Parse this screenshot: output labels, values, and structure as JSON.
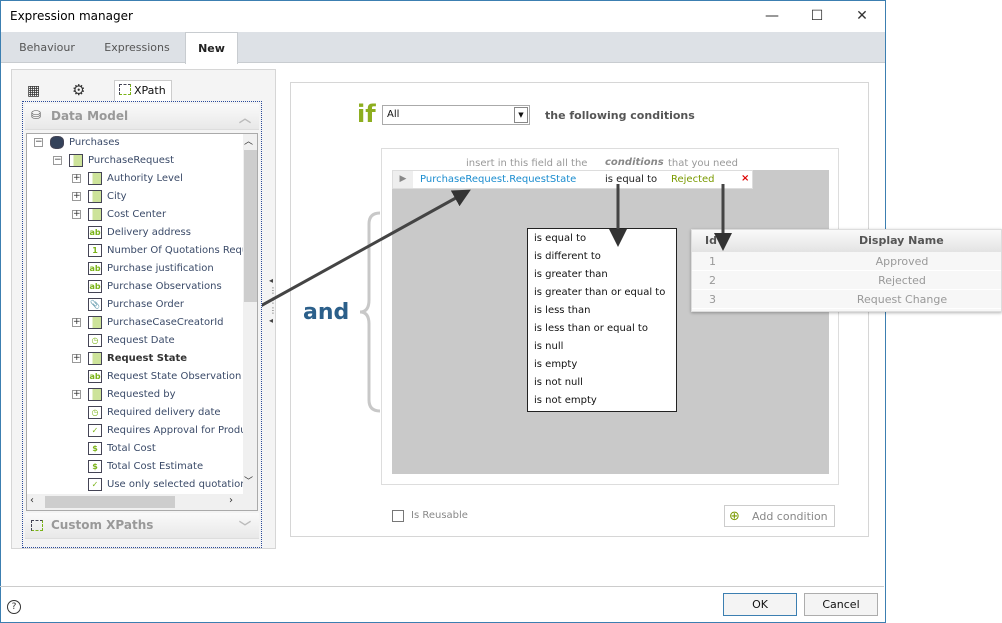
{
  "window": {
    "title": "Expression manager",
    "minimize": "—",
    "maximize": "☐",
    "close": "✕"
  },
  "tabs": [
    {
      "label": "Behaviour"
    },
    {
      "label": "Expressions"
    },
    {
      "label": "New"
    }
  ],
  "left": {
    "xpath_tab": "XPath",
    "data_model": "Data Model",
    "custom_xpaths": "Custom XPaths",
    "tree": [
      {
        "label": "Purchases",
        "level": 0,
        "exp": "−",
        "icon": "entity-icon"
      },
      {
        "label": "PurchaseRequest",
        "level": 1,
        "exp": "−",
        "icon": "process-entity-icon"
      },
      {
        "label": "Authority Level",
        "level": 2,
        "exp": "+",
        "icon": "table-icon"
      },
      {
        "label": "City",
        "level": 2,
        "exp": "+",
        "icon": "table-icon"
      },
      {
        "label": "Cost Center",
        "level": 2,
        "exp": "+",
        "icon": "table-icon"
      },
      {
        "label": "Delivery address",
        "level": 2,
        "icon": "text-icon",
        "glyph": "ab"
      },
      {
        "label": "Number Of Quotations Requi",
        "level": 2,
        "icon": "number-icon",
        "glyph": "1"
      },
      {
        "label": "Purchase justification",
        "level": 2,
        "icon": "text-icon",
        "glyph": "ab"
      },
      {
        "label": "Purchase Observations",
        "level": 2,
        "icon": "text-icon",
        "glyph": "ab"
      },
      {
        "label": "Purchase Order",
        "level": 2,
        "icon": "attachment-icon",
        "glyph": "📎"
      },
      {
        "label": "PurchaseCaseCreatorId",
        "level": 2,
        "exp": "+",
        "icon": "collection-icon"
      },
      {
        "label": "Request Date",
        "level": 2,
        "icon": "date-icon",
        "glyph": "◷"
      },
      {
        "label": "Request State",
        "level": 2,
        "exp": "+",
        "icon": "table-icon",
        "bold": true
      },
      {
        "label": "Request State Observation",
        "level": 2,
        "icon": "text-icon",
        "glyph": "ab"
      },
      {
        "label": "Requested by",
        "level": 2,
        "exp": "+",
        "icon": "collection-icon"
      },
      {
        "label": "Required delivery date",
        "level": 2,
        "icon": "date-icon",
        "glyph": "◷"
      },
      {
        "label": "Requires Approval for Produc",
        "level": 2,
        "icon": "checkbox-icon",
        "glyph": "✓"
      },
      {
        "label": "Total Cost",
        "level": 2,
        "icon": "currency-icon",
        "glyph": "$"
      },
      {
        "label": "Total Cost Estimate",
        "level": 2,
        "icon": "currency-icon",
        "glyph": "$"
      },
      {
        "label": "Use only selected quotations",
        "level": 2,
        "icon": "checkbox-icon",
        "glyph": "✓"
      }
    ]
  },
  "editor": {
    "if": "if",
    "quantifier": "All",
    "following": "the following conditions",
    "and": "and",
    "hint1": "insert in this field all the",
    "hint2": "conditions",
    "hint3": "that you need",
    "condition": {
      "field_prefix": "PurchaseRequest.",
      "field": "RequestState",
      "operator": "is equal to",
      "value": "Rejected"
    },
    "is_reusable": "Is Reusable",
    "add_condition": "Add condition"
  },
  "operators": [
    "is equal to",
    "is different to",
    "is greater than",
    "is greater than or equal to",
    "is less than",
    "is less than or equal to",
    "is null",
    "is empty",
    "is not null",
    "is not empty"
  ],
  "display_table": {
    "headers": [
      "Id",
      "Display Name"
    ],
    "rows": [
      [
        "1",
        "Approved"
      ],
      [
        "2",
        "Rejected"
      ],
      [
        "3",
        "Request Change"
      ]
    ]
  },
  "footer": {
    "ok": "OK",
    "cancel": "Cancel",
    "help": "?"
  },
  "colors": {
    "accent_green": "#8dae1f",
    "and_blue": "#2b5f8a",
    "field_blue": "#1a8ccf"
  }
}
